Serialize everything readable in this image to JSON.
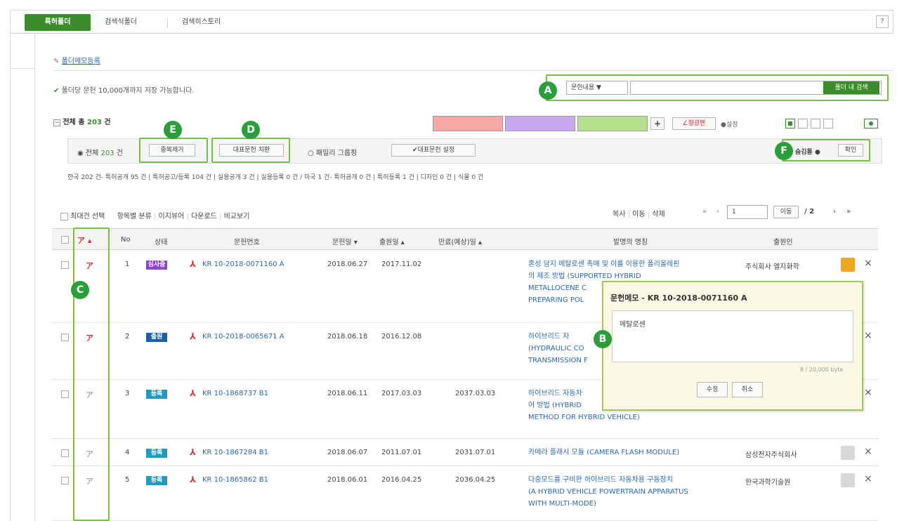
{
  "tabs": [
    "특허폴더",
    "검색식폴더",
    "검색히스토리"
  ],
  "help_label": "?",
  "folder_memo_link": "폴더메모등록",
  "info_text": "폴더당 문헌 10,000개까지 저장 가능합니다.",
  "search": {
    "select_value": "문헌내용 ▼",
    "input_value": "",
    "button_label": "폴더 내 검색"
  },
  "total": {
    "label": "전체 총",
    "count": "203",
    "unit": "건"
  },
  "toolbar": {
    "plus": "+",
    "marker_label": "형광펜",
    "settings_label": "설정"
  },
  "filter": {
    "all_label": "전체",
    "all_count": "203",
    "all_unit": "건",
    "dedup_button": "중복제거",
    "rep_replace_button": "대표문헌 치환",
    "family_group_label": "패밀리 그룹핑",
    "rep_set_button": "✔대표문헌 설정",
    "read_label": "숨김통",
    "confirm_button": "확인"
  },
  "country_line": "한국 202 건- 특허공개 95 건 | 특허공고/등록 104 건 | 실용공개 3 건 | 실용등록 0 건 / 미국 1 건- 특허공개 0 건 | 특허등록 1 건 | 디자인 0 건 | 식물 0 건",
  "actions": [
    "최대건 선택",
    "항목별 분류",
    "이지뷰어",
    "다운로드",
    "비교보기"
  ],
  "right_actions": [
    "복사",
    "이동",
    "삭제"
  ],
  "pager": {
    "first": "«",
    "prev": "‹",
    "page_value": "1",
    "go_label": "이동",
    "total": "/ 2",
    "next": "›",
    "last": "»"
  },
  "columns": [
    "No",
    "상태",
    "문헌번호",
    "문헌일 ▾",
    "출원일 ▴",
    "만료(예상)일 ▴",
    "발명의 명칭",
    "출원인"
  ],
  "rows": [
    {
      "no": "1",
      "status": "심사중",
      "status_color": "#8e44c9",
      "doc": "KR 10-2018-0071160 A",
      "pub": "2018.06.27",
      "app": "2017.11.02",
      "exp": "",
      "title": [
        "혼성 담지 메탈로센 촉매 및 이를 이용한 폴리올레핀",
        "의 제조 방법 (SUPPORTED HYBRID",
        "METALLOCENE C",
        "PREPARING POL"
      ],
      "applicant": "주식회사 엘지화학"
    },
    {
      "no": "2",
      "status": "출원",
      "status_color": "#1d5fa8",
      "doc": "KR 10-2018-0065671 A",
      "pub": "2018.06.18",
      "app": "2016.12.08",
      "exp": "",
      "title": [
        "하이브리드 자",
        "(HYDRAULIC CO",
        "TRANSMISSION F"
      ],
      "applicant": ""
    },
    {
      "no": "3",
      "status": "등록",
      "status_color": "#1e9cc0",
      "doc": "KR 10-1868737 B1",
      "pub": "2018.06.11",
      "app": "2017.03.03",
      "exp": "2037.03.03",
      "title": [
        "하이브리드 자동차",
        "어 방법 (HYBRID",
        "METHOD FOR HYBRID VEHICLE)"
      ],
      "applicant": ""
    },
    {
      "no": "4",
      "status": "등록",
      "status_color": "#1e9cc0",
      "doc": "KR 10-1867284 B1",
      "pub": "2018.06.07",
      "app": "2011.07.01",
      "exp": "2031.07.01",
      "title": [
        "카메라 플래시 모듈 (CAMERA FLASH MODULE)"
      ],
      "applicant": "삼성전자주식회사"
    },
    {
      "no": "5",
      "status": "등록",
      "status_color": "#1e9cc0",
      "doc": "KR 10-1865862 B1",
      "pub": "2018.06.01",
      "app": "2016.04.25",
      "exp": "2036.04.25",
      "title": [
        "다중모드를 구비한 하이브리드 자동차용 구동장치",
        "(A HYBRID VEHICLE POWERTRAIN APPARATUS",
        "WITH MULTI-MODE)"
      ],
      "applicant": "한국과학기술원"
    }
  ],
  "popup": {
    "title": "문헌메모 - KR 10-2018-0071160 A",
    "text": "메탈로센",
    "counter": "8 / 20,000 byte",
    "edit_button": "수정",
    "cancel_button": "취소"
  },
  "callouts": [
    "A",
    "B",
    "C",
    "D",
    "E",
    "F"
  ],
  "colors": {
    "brand": "#3b8c2b",
    "callout": "#76c043",
    "link": "#2a66b0",
    "swatch_red": "#f8a6a6",
    "swatch_purple": "#c9a8f0",
    "swatch_green": "#b7e08e"
  }
}
